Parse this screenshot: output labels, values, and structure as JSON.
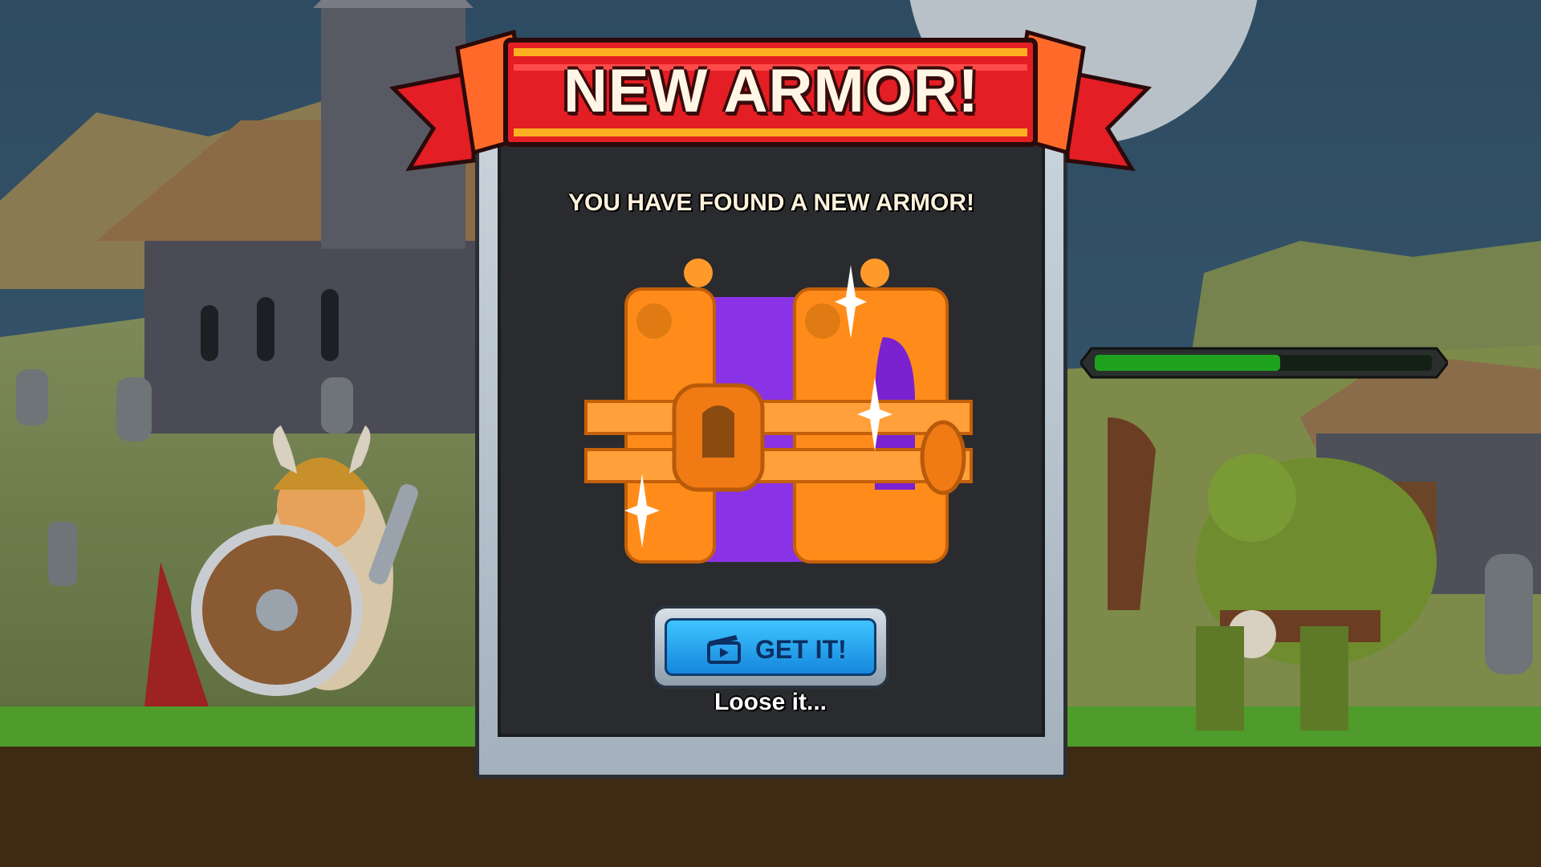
{
  "popup": {
    "title": "NEW ARMOR!",
    "subtitle": "YOU HAVE FOUND A NEW ARMOR!",
    "primary_button": {
      "label": "GET IT!",
      "icon": "video-clapper-icon"
    },
    "secondary_link": "Loose it..."
  },
  "hud": {
    "enemy_health_fraction": 0.55
  },
  "colors": {
    "ribbon": "#e31e24",
    "ribbon_stripe": "#ffb020",
    "button_blue": "#2aa8f2",
    "chest_orange": "#ff8c1a",
    "chest_purple": "#8a32e6",
    "health_green": "#1ea21e"
  }
}
